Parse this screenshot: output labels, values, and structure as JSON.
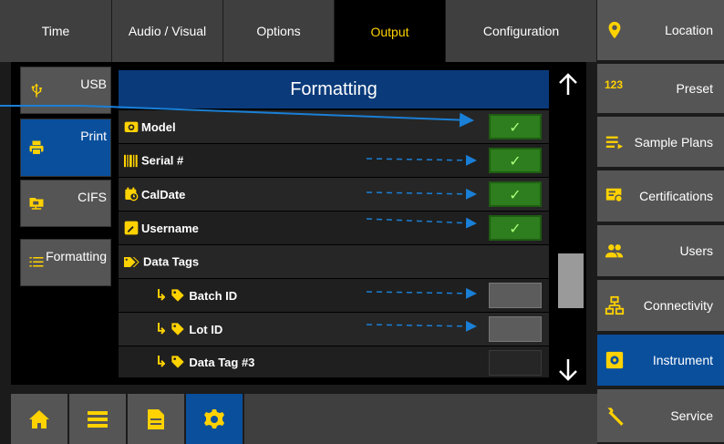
{
  "tabs": [
    {
      "label": "Time"
    },
    {
      "label": "Audio / Visual"
    },
    {
      "label": "Options"
    },
    {
      "label": "Output"
    },
    {
      "label": "Configuration"
    }
  ],
  "active_tab": "Output",
  "right_sidebar": [
    {
      "label": "Location",
      "icon": "location-pin-icon"
    },
    {
      "label": "Preset",
      "icon": "numbers-123-icon"
    },
    {
      "label": "Sample Plans",
      "icon": "list-arrow-icon"
    },
    {
      "label": "Certifications",
      "icon": "certificate-icon"
    },
    {
      "label": "Users",
      "icon": "users-icon"
    },
    {
      "label": "Connectivity",
      "icon": "network-icon"
    },
    {
      "label": "Instrument",
      "icon": "gear-box-icon"
    },
    {
      "label": "Service",
      "icon": "wrench-icon"
    }
  ],
  "active_sidebar": "Instrument",
  "left_nav": [
    {
      "label": "USB",
      "icon": "usb-icon"
    },
    {
      "label": "Print",
      "icon": "printer-icon"
    },
    {
      "label": "CIFS",
      "icon": "network-folder-icon"
    },
    {
      "label": "Formatting",
      "icon": "list-format-icon"
    }
  ],
  "active_left_nav": "Print",
  "panel": {
    "title": "Formatting",
    "rows": [
      {
        "label": "Model",
        "checked": true
      },
      {
        "label": "Serial #",
        "checked": true
      },
      {
        "label": "CalDate",
        "checked": true
      },
      {
        "label": "Username",
        "checked": true
      },
      {
        "label": "Data Tags"
      },
      {
        "label": "Batch ID",
        "checked": false
      },
      {
        "label": "Lot ID",
        "checked": false
      },
      {
        "label": "Data Tag #3",
        "checked": false
      }
    ],
    "checkmark": "✓"
  },
  "colors": {
    "accent": "#0a4f9c",
    "active_tab_text": "#ffd200",
    "check_on": "#2e7d1e",
    "icon_yellow": "#ffd200"
  }
}
